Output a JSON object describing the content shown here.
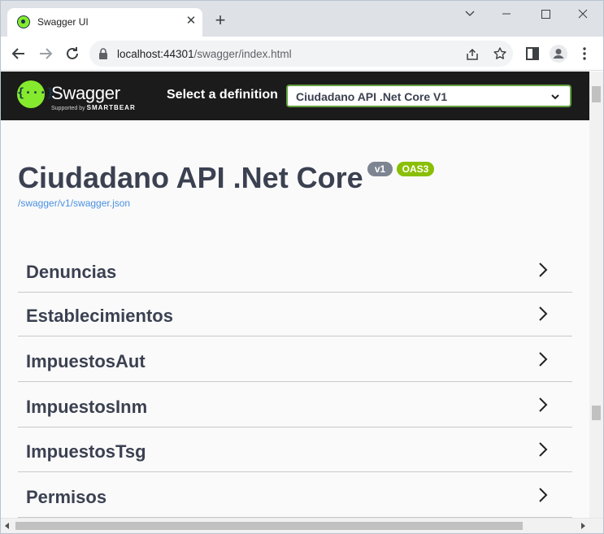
{
  "browser": {
    "tab_title": "Swagger UI",
    "url_host": "localhost:44301",
    "url_path": "/swagger/index.html"
  },
  "swagger": {
    "logo_text": "Swagger",
    "logo_sub_prefix": "Supported by",
    "logo_sub_brand": "SMARTBEAR",
    "select_label": "Select a definition",
    "selected_definition": "Ciudadano API .Net Core V1",
    "info_title": "Ciudadano API .Net Core",
    "version_badge": "v1",
    "oas_badge": "OAS3",
    "spec_link": "/swagger/v1/swagger.json",
    "tags": [
      {
        "name": "Denuncias"
      },
      {
        "name": "Establecimientos"
      },
      {
        "name": "ImpuestosAut"
      },
      {
        "name": "ImpuestosInm"
      },
      {
        "name": "ImpuestosTsg"
      },
      {
        "name": "Permisos"
      }
    ]
  },
  "colors": {
    "topbar": "#1b1b1b",
    "swagger_green": "#85ea2d",
    "select_border": "#62a03f",
    "version_badge": "#7d8492",
    "oas_badge": "#89bf04",
    "link": "#4990e2",
    "text": "#3b4151"
  },
  "icons": [
    "swagger-logo-icon",
    "chevron-right-icon",
    "chevron-down-icon",
    "lock-icon",
    "back-arrow-icon",
    "forward-arrow-icon",
    "reload-icon",
    "share-icon",
    "star-icon",
    "sidepanel-icon",
    "profile-icon",
    "more-icon"
  ]
}
